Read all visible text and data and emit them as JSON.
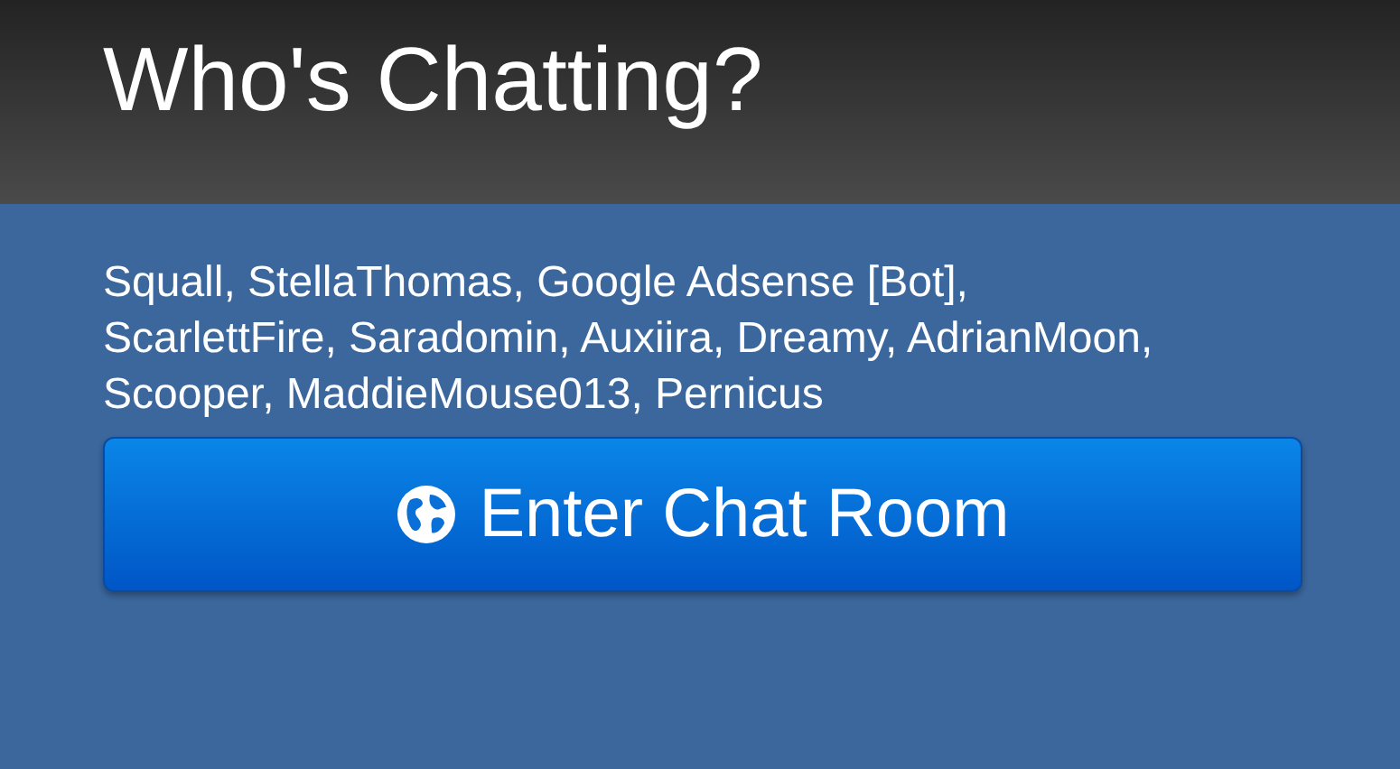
{
  "header": {
    "title": "Who's Chatting?"
  },
  "users_text": "Squall, StellaThomas, Google Adsense [Bot], ScarlettFire, Saradomin, Auxiira, Dreamy, AdrianMoon, Scooper, MaddieMouse013, Pernicus",
  "button": {
    "label": "Enter Chat Room"
  }
}
